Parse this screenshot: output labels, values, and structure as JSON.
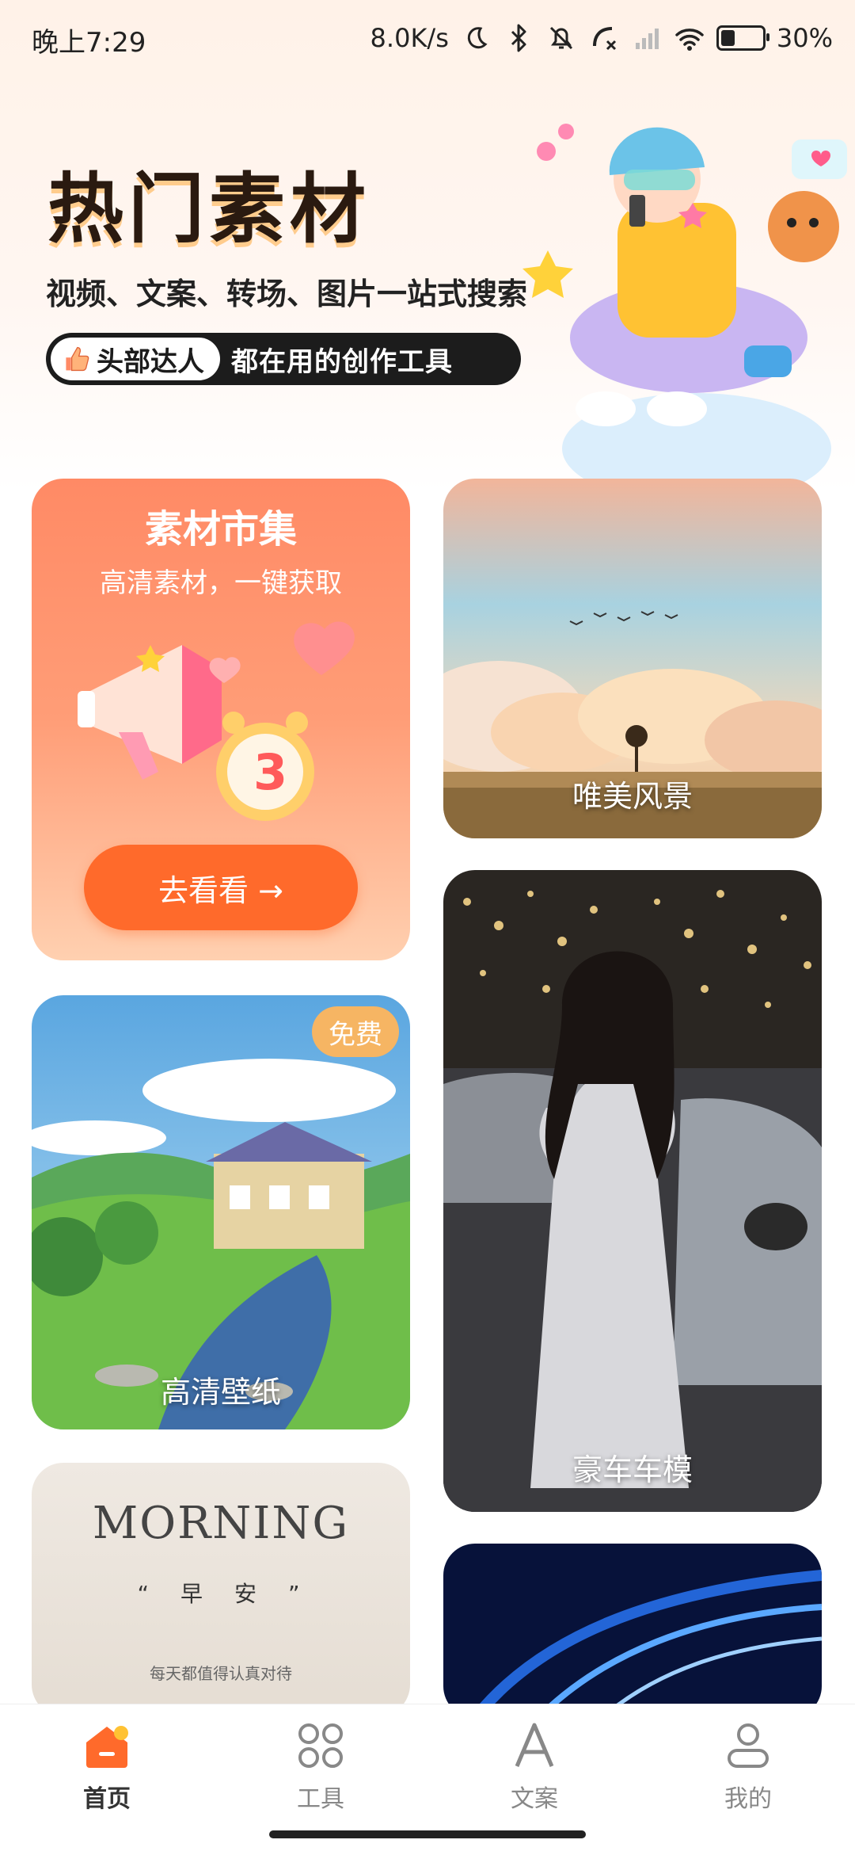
{
  "status_bar": {
    "time": "晚上7:29",
    "net_speed": "8.0K/s",
    "battery": "30%"
  },
  "hero": {
    "title": "热门素材",
    "subtitle": "视频、文案、转场、图片一站式搜索",
    "pill_badge": "头部达人",
    "pill_text": "都在用的创作工具"
  },
  "cards": {
    "market": {
      "title": "素材市集",
      "subtitle": "高清素材，一键获取",
      "button": "去看看 →"
    },
    "scenery": {
      "label": "唯美风景"
    },
    "wallpaper": {
      "label": "高清壁纸",
      "badge": "免费"
    },
    "car_model": {
      "label": "豪车车模"
    },
    "morning": {
      "word": "MORNING",
      "sub": "“　早　安　”",
      "small": "每天都值得认真对待"
    }
  },
  "bottom_nav": {
    "items": [
      {
        "label": "首页",
        "icon": "home-icon",
        "active": true
      },
      {
        "label": "工具",
        "icon": "grid-icon",
        "active": false
      },
      {
        "label": "文案",
        "icon": "letter-a-icon",
        "active": false
      },
      {
        "label": "我的",
        "icon": "profile-icon",
        "active": false
      }
    ]
  },
  "colors": {
    "accent": "#ff6a2b",
    "card_orange": "#ff8a65",
    "badge": "#f6b563"
  }
}
